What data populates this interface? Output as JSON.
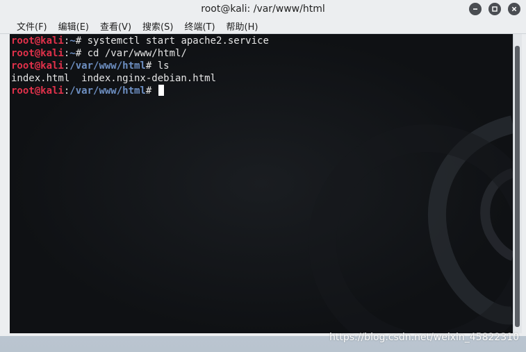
{
  "window": {
    "title": "root@kali: /var/www/html",
    "controls": [
      "minimize",
      "maximize",
      "close"
    ]
  },
  "menu": [
    {
      "label": "文件(F)"
    },
    {
      "label": "编辑(E)"
    },
    {
      "label": "查看(V)"
    },
    {
      "label": "搜索(S)"
    },
    {
      "label": "终端(T)"
    },
    {
      "label": "帮助(H)"
    }
  ],
  "terminal": {
    "lines": [
      {
        "user": "root@kali",
        "sep": ":",
        "path": "~",
        "sym": "# ",
        "cmd": "systemctl start apache2.service"
      },
      {
        "user": "root@kali",
        "sep": ":",
        "path": "~",
        "sym": "# ",
        "cmd": "cd /var/www/html/"
      },
      {
        "user": "root@kali",
        "sep": ":",
        "path": "/var/www/html",
        "sym": "# ",
        "cmd": "ls"
      },
      {
        "output": "index.html  index.nginx-debian.html"
      },
      {
        "user": "root@kali",
        "sep": ":",
        "path": "/var/www/html",
        "sym": "# ",
        "cmd": ""
      }
    ],
    "colors": {
      "background": "#0f1114",
      "user": "#e0314a",
      "path": "#6d8fc2",
      "text": "#e6e6e6"
    }
  },
  "watermark": "https://blog.csdn.net/weixin_45822310"
}
